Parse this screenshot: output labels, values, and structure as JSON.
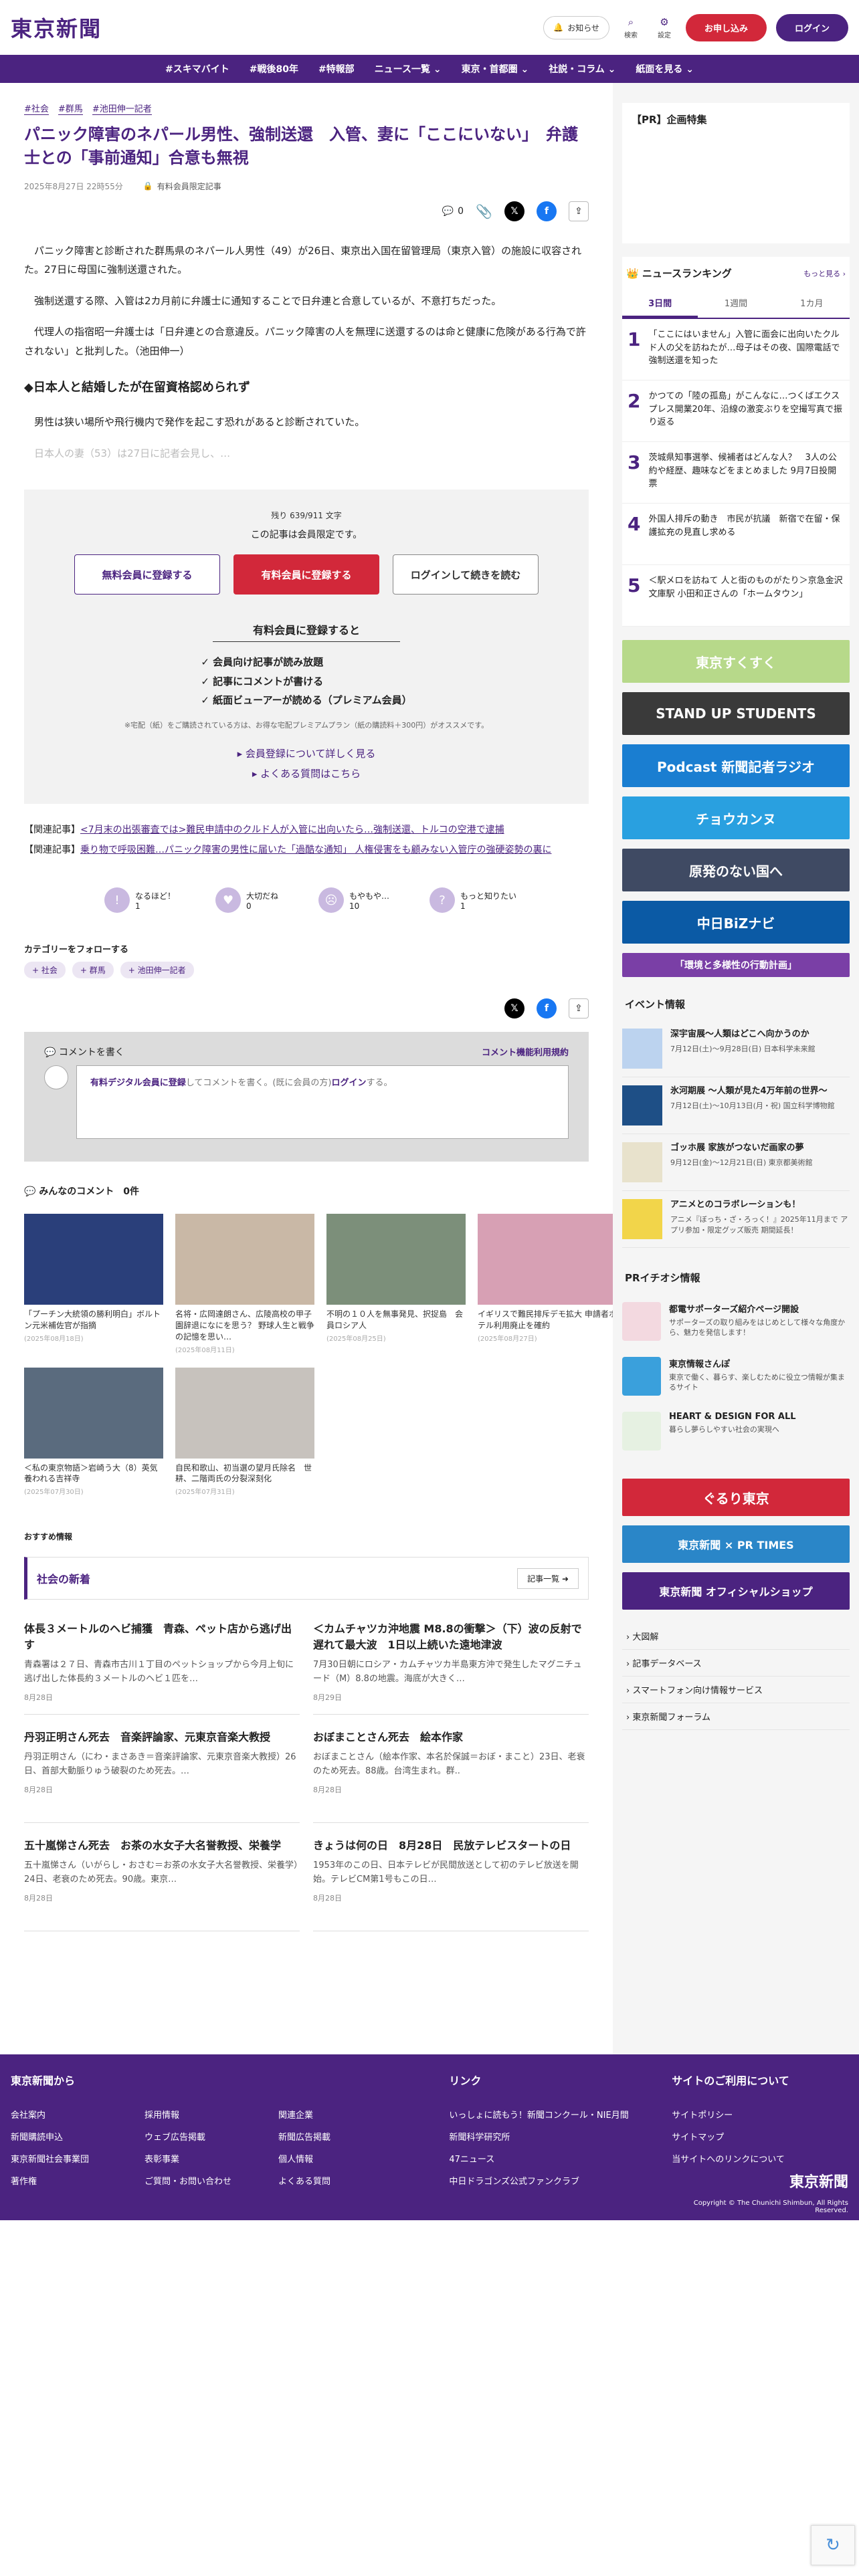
{
  "header": {
    "logo": "東京新聞",
    "notice": "お知らせ",
    "search": "検索",
    "settings": "設定",
    "subscribe": "お申し込み",
    "login": "ログイン"
  },
  "nav": [
    "#スキマバイト",
    "#戦後80年",
    "#特報部",
    "ニュース一覧 ⌄",
    "東京・首都圏 ⌄",
    "社説・コラム ⌄",
    "紙面を見る ⌄"
  ],
  "article": {
    "tags": [
      "#社会",
      "#群馬",
      "#池田伸一記者"
    ],
    "title": "パニック障害のネパール男性、強制送還　入管、妻に「ここにいない」　弁護士との「事前通知」合意も無視",
    "date": "2025年8月27日 22時55分",
    "member_badge": "有料会員限定記事",
    "comment_count": "0",
    "paragraphs": [
      "パニック障害と診断された群馬県のネパール人男性（49）が26日、東京出入国在留管理局（東京入管）の施設に収容された。27日に母国に強制送還された。",
      "強制送還する際、入管は2カ月前に弁護士に通知することで日弁連と合意しているが、不意打ちだった。",
      "代理人の指宿昭一弁護士は「日弁連との合意違反。パニック障害の人を無理に送還するのは命と健康に危険がある行為で許されない」と批判した。（池田伸一）"
    ],
    "subhead": "◆日本人と結婚したが在留資格認められず",
    "paragraph4": "男性は狭い場所や飛行機内で発作を起こす恐れがあると診断されていた。",
    "faded": "日本人の妻（53）は27日に記者会見し、…"
  },
  "paywall": {
    "remain": "残り 639/911 文字",
    "msg": "この記事は会員限定です。",
    "free_btn": "無料会員に登録する",
    "paid_btn": "有料会員に登録する",
    "login_btn": "ログインして続きを読む",
    "benefit_title": "有料会員に登録すると",
    "benefits": [
      "✓ 会員向け記事が読み放題",
      "✓ 記事にコメントが書ける",
      "✓ 紙面ビューアーが読める（プレミアム会員）"
    ],
    "note": "※宅配（紙）をご購読されている方は、お得な宅配プレミアムプラン（紙の購読料＋300円）がオススメです。",
    "link1": "▸ 会員登録について詳しく見る",
    "link2": "▸ よくある質問はこちら"
  },
  "related": [
    {
      "label": "【関連記事】",
      "text": "<7月末の出張審査では>難民申請中のクルド人が入管に出向いたら…強制送還、トルコの空港で逮捕"
    },
    {
      "label": "【関連記事】",
      "text": "乗り物で呼吸困難…パニック障害の男性に届いた「過酷な通知」 人権侵害をも顧みない入管庁の強硬姿勢の裏に"
    }
  ],
  "reactions": [
    {
      "label": "なるほど！",
      "count": "1"
    },
    {
      "label": "大切だね",
      "count": "0"
    },
    {
      "label": "もやもや…",
      "count": "10"
    },
    {
      "label": "もっと知りたい",
      "count": "1"
    }
  ],
  "follow": {
    "title": "カテゴリーをフォローする",
    "tags": [
      "+ 社会",
      "+ 群馬",
      "+ 池田伸一記者"
    ]
  },
  "comment_box": {
    "title": "コメントを書く",
    "rules": "コメント機能利用規約",
    "placeholder_a": "有料デジタル会員に登録",
    "placeholder_b": "してコメントを書く。(既に会員の方)",
    "placeholder_c": "ログイン",
    "placeholder_d": "する。"
  },
  "all_comments": "みんなのコメント　0件",
  "thumbs": [
    {
      "cap": "「プーチン大統領の勝利明白」ボルトン元米補佐官が指摘",
      "date": "(2025年08月18日)",
      "color": "#2a3f7a"
    },
    {
      "cap": "名将・広岡達朗さん、広陵高校の甲子園辞退になにを思う？ 野球人生と戦争の記憶を思い…",
      "date": "(2025年08月11日)",
      "color": "#c9b8a6"
    },
    {
      "cap": "不明の１０人を無事発見、択捉島　会員ロシア人",
      "date": "(2025年08月25日)",
      "color": "#7c8f7a"
    },
    {
      "cap": "イギリスで難民排斥デモ拡大 申請者ホテル利用廃止を確約",
      "date": "(2025年08月27日)",
      "color": "#d7a0b4"
    },
    {
      "cap": "＜私の東京物語＞岩崎う大（8）英気養われる吉祥寺",
      "date": "(2025年07月30日)",
      "color": "#5a6b7e"
    },
    {
      "cap": "自民和歌山、初当選の望月氏除名　世耕、二階両氏の分裂深刻化",
      "date": "(2025年07月31日)",
      "color": "#c7c2bd"
    }
  ],
  "recommend": "おすすめ情報",
  "news": {
    "heading": "社会の新着",
    "more": "記事一覧 ➜",
    "items": [
      {
        "t": "体長３メートルのヘビ捕獲　青森、ペット店から逃げ出す",
        "d": "青森署は２７日、青森市古川１丁目のペットショップから今月上旬に逃げ出した体長約３メートルのヘビ１匹を…",
        "dt": "8月28日"
      },
      {
        "t": "＜カムチャツカ沖地震 M8.8の衝撃＞（下）波の反射で遅れて最大波　1日以上続いた遠地津波",
        "d": "7月30日朝にロシア・カムチャツカ半島東方沖で発生したマグニチュード（M）8.8の地震。海底が大きく…",
        "dt": "8月29日"
      },
      {
        "t": "丹羽正明さん死去　音楽評論家、元東京音楽大教授",
        "d": "丹羽正明さん（にわ・まさあき＝音楽評論家、元東京音楽大教授）26日、首部大動脈りゅう破裂のため死去。…",
        "dt": "8月28日"
      },
      {
        "t": "おぼまことさん死去　絵本作家",
        "d": "おぼまことさん（絵本作家、本名於保誠＝おぼ・まこと）23日、老衰のため死去。88歳。台湾生まれ。群..",
        "dt": "8月28日"
      },
      {
        "t": "五十嵐悌さん死去　お茶の水女子大名誉教授、栄養学",
        "d": "五十嵐悌さん（いがらし・おさむ＝お茶の水女子大名誉教授、栄養学）24日、老衰のため死去。90歳。東京…",
        "dt": "8月28日"
      },
      {
        "t": "きょうは何の日　8月28日　民放テレビスタートの日",
        "d": "1953年のこの日、日本テレビが民間放送として初のテレビ放送を開始。テレビCM第1号もこの日…",
        "dt": "8月28日"
      }
    ]
  },
  "side": {
    "pr_title": "【PR】企画特集",
    "ranking_title": "ニュースランキング",
    "ranking_more": "もっと見る ›",
    "ranking_tabs": [
      "3日間",
      "1週間",
      "1カ月"
    ],
    "ranking": [
      {
        "n": "1",
        "t": "「ここにはいません」入管に面会に出向いたクルド人の父を訪ねたが…母子はその夜、国際電話で強制送還を知った"
      },
      {
        "n": "2",
        "t": "かつての「陸の孤島」がこんなに…つくばエクスプレス開業20年、沿線の激変ぶりを空撮写真で振り返る"
      },
      {
        "n": "3",
        "t": "茨城県知事選挙、候補者はどんな人？　3人の公約や経歴、趣味などをまとめました 9月7日投開票"
      },
      {
        "n": "4",
        "t": "外国人排斥の動き　市民が抗議　新宿で在留・保護拡充の見直し求める"
      },
      {
        "n": "5",
        "t": "＜駅メロを訪ねて 人と街のものがたり＞京急金沢文庫駅 小田和正さんの「ホームタウン」"
      }
    ],
    "banners": [
      {
        "text": "東京すくすく",
        "color": "#b7d98a"
      },
      {
        "text": "STAND UP STUDENTS",
        "color": "#3a3a3a"
      },
      {
        "text": "Podcast 新聞記者ラジオ",
        "color": "#1a7ed1"
      },
      {
        "text": "チョウカンヌ",
        "color": "#29a0e0"
      },
      {
        "text": "原発のない国へ",
        "color": "#3f4a63"
      },
      {
        "text": "中日BiZナビ",
        "color": "#0b5aa5"
      },
      {
        "text": "「環境と多様性の行動計画」",
        "color": "#7a3fa6"
      }
    ],
    "event_title": "イベント情報",
    "events": [
      {
        "t": "深宇宙展〜人類はどこへ向かうのか",
        "d": "7月12日(土)〜9月28日(日) 日本科学未来館",
        "color": "#bcd3ef"
      },
      {
        "t": "氷河期展 〜人類が見た4万年前の世界〜",
        "d": "7月12日(土)〜10月13日(月・祝) 国立科学博物館",
        "color": "#1e4f86"
      },
      {
        "t": "ゴッホ展 家族がつないだ画家の夢",
        "d": "9月12日(金)〜12月21日(日) 東京都美術館",
        "color": "#e8e2cc"
      },
      {
        "t": "アニメとのコラボレーションも！",
        "d": "アニメ『ぼっち・ざ・ろっく！』2025年11月まで アプリ参加・限定グッズ販売 期間延長！",
        "color": "#f2d54a"
      }
    ],
    "pr_section": "PRイチオシ情報",
    "pr_items": [
      {
        "t": "都電サポーターズ紹介ページ開設",
        "d": "サポーターズの取り組みをはじめとして様々な角度から、魅力を発信します！",
        "color": "#f3d9e0"
      },
      {
        "t": "東京情報さんぽ",
        "d": "東京で働く、暮らす、楽しむために役立つ情報が集まるサイト",
        "color": "#3aa0dc"
      },
      {
        "t": "HEART & DESIGN FOR ALL",
        "d": "暮らし夢らしやすい社会の実現へ",
        "color": "#e6f1e2"
      }
    ],
    "ad_banners": [
      {
        "text": "ぐるり東京",
        "color": "#d2283a"
      },
      {
        "text": "東京新聞 × PR TIMES",
        "color": "#2a86c8"
      },
      {
        "text": "東京新聞 オフィシャルショップ",
        "color": "#4b2380"
      }
    ],
    "list": [
      "› 大図解",
      "› 記事データベース",
      "› スマートフォン向け情報サービス",
      "› 東京新聞フォーラム"
    ]
  },
  "footer": {
    "col1_title": "東京新聞から",
    "col1": [
      "会社案内",
      "採用情報",
      "関連企業",
      "新聞購読申込",
      "ウェブ広告掲載",
      "新聞広告掲載",
      "東京新聞社会事業団",
      "表彰事業",
      "個人情報",
      "著作権",
      "ご質問・お問い合わせ",
      "よくある質問"
    ],
    "col2_title": "リンク",
    "col2": [
      "いっしょに読もう！新聞コンクール・NIE月間",
      "新聞科学研究所",
      "47ニュース",
      "中日ドラゴンズ公式ファンクラブ"
    ],
    "col3_title": "サイトのご利用について",
    "col3": [
      "サイトポリシー",
      "サイトマップ",
      "当サイトへのリンクについて"
    ],
    "logo": "東京新聞",
    "copyright": "Copyright © The Chunichi Shimbun, All Rights Reserved."
  },
  "colors": {
    "brand": "#4b2380",
    "accent_red": "#d2283a"
  }
}
